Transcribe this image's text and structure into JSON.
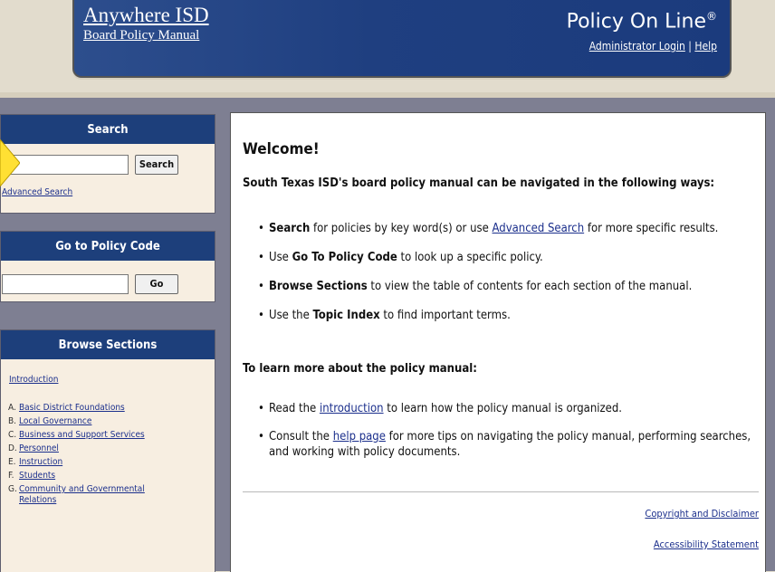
{
  "header": {
    "site_name": "Anywhere ISD",
    "manual_name": "Board Policy Manual",
    "brand": "Policy On Line",
    "brand_mark": "®",
    "admin_login": "Administrator Login",
    "separator": "|",
    "help": "Help"
  },
  "sidebar": {
    "search": {
      "title": "Search",
      "input_value": "",
      "button": "Search",
      "advanced_link": "Advanced Search"
    },
    "policy_code": {
      "title": "Go to Policy Code",
      "input_value": "",
      "button": "Go"
    },
    "browse": {
      "title": "Browse Sections",
      "intro_link": "Introduction",
      "sections": [
        {
          "letter": "A.",
          "name": "Basic District Foundations"
        },
        {
          "letter": "B.",
          "name": "Local Governance"
        },
        {
          "letter": "C.",
          "name": "Business and Support Services"
        },
        {
          "letter": "D.",
          "name": "Personnel"
        },
        {
          "letter": "E.",
          "name": "Instruction"
        },
        {
          "letter": "F.",
          "name": "Students"
        },
        {
          "letter": "G.",
          "name": "Community and Governmental Relations"
        }
      ]
    }
  },
  "main": {
    "welcome": "Welcome!",
    "intro": "South Texas ISD's board policy manual can be navigated in the following ways:",
    "ways": [
      {
        "bold": "Search",
        "text1": " for policies by key word(s) or use ",
        "link": "Advanced Search",
        "text2": " for more specific results."
      },
      {
        "pre": "Use ",
        "bold": "Go To Policy Code",
        "text": " to look up a specific policy."
      },
      {
        "bold": "Browse Sections",
        "text": " to view the table of contents for each section of the manual."
      },
      {
        "pre": "Use the ",
        "bold": "Topic Index",
        "text": " to find important terms."
      }
    ],
    "learn_title": "To learn more about the policy manual:",
    "learn": [
      {
        "pre": "Read the ",
        "link": "introduction",
        "text": " to learn how the policy manual is organized."
      },
      {
        "pre": "Consult the ",
        "link": "help page",
        "text": " for more tips on navigating the policy manual, performing searches, and working with policy documents."
      }
    ],
    "footer": {
      "copyright": "Copyright and Disclaimer",
      "accessibility": "Accessibility Statement"
    }
  },
  "colors": {
    "header_blue": "#1f3f80",
    "box_header_blue": "#1d3f7b",
    "band_gray": "#7e7f92",
    "page_beige": "#e2dccd",
    "link_blue": "#1b2f8c",
    "arrow_yellow": "#ffe033"
  }
}
